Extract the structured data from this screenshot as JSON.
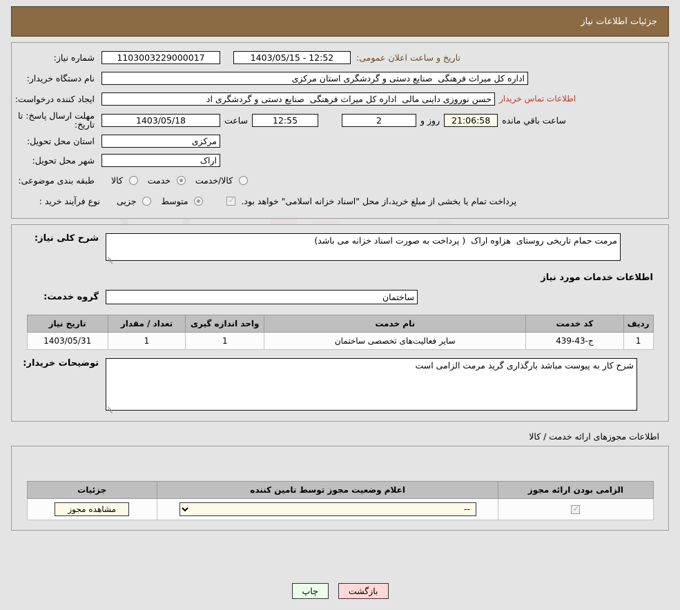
{
  "header": {
    "title": "جزئیات اطلاعات نیاز"
  },
  "form": {
    "need_number_label": "شماره نیاز:",
    "need_number_value": "1103003229000017",
    "announce_datetime_label": "تاریخ و ساعت اعلان عمومی:",
    "announce_datetime_value": "1403/05/15 - 12:52",
    "buyer_org_label": "نام دستگاه خریدار:",
    "buyer_org_value": "اداره کل میراث فرهنگی  صنایع دستی و گردشگری استان مرکزی",
    "requester_label": "ایجاد کننده درخواست:",
    "requester_value": "حسن نوروزی داینی مالی  اداره کل میراث فرهنگی  صنایع دستی و گردشگری اد",
    "buyer_contact_link": "اطلاعات تماس خریدار",
    "deadline_label": "مهلت ارسال پاسخ: تا تاریخ:",
    "deadline_date": "1403/05/18",
    "deadline_hour_label": "ساعت",
    "deadline_hour": "12:55",
    "remaining_days": "2",
    "remaining_days_label": "روز و",
    "remaining_time": "21:06:58",
    "remaining_time_label": "ساعت باقي مانده",
    "province_label": "استان محل تحویل:",
    "province_value": "مرکزی",
    "city_label": "شهر محل تحویل:",
    "city_value": "اراک",
    "category_label": "طبقه بندی موضوعی:",
    "category_options": [
      {
        "label": "کالا",
        "selected": false
      },
      {
        "label": "خدمت",
        "selected": true
      },
      {
        "label": "کالا/خدمت",
        "selected": false
      }
    ],
    "process_type_label": "نوع فرآیند خرید :",
    "process_options": [
      {
        "label": "جزیی",
        "selected": false
      },
      {
        "label": "متوسط",
        "selected": true
      }
    ],
    "treasury_checked": true,
    "treasury_note": "پرداخت تمام یا بخشی از مبلغ خرید،از محل \"اسناد خزانه اسلامی\" خواهد بود."
  },
  "need_description": {
    "label": "شرح کلی نیاز:",
    "value": "مرمت حمام تاریخی روستای  هزاوه اراک  ( پرداخت به صورت اسناد خزانه می باشد)"
  },
  "services_section": {
    "title": "اطلاعات خدمات مورد نیاز",
    "service_group_label": "گروه خدمت:",
    "service_group_value": "ساختمان",
    "table": {
      "columns": [
        "ردیف",
        "کد خدمت",
        "نام خدمت",
        "واحد اندازه گیری",
        "تعداد / مقدار",
        "تاریخ نیاز"
      ],
      "rows": [
        [
          "1",
          "ج-43-439",
          "سایر فعالیت‌های تخصصی ساختمان",
          "1",
          "1",
          "1403/05/31"
        ]
      ]
    },
    "buyer_notes_label": "توضیحات خریدار:",
    "buyer_notes_value": "شرح کار به پیوست مباشد بارگذاری گرید مرمت الزامی است"
  },
  "licenses_section": {
    "title": "اطلاعات مجوزهای ارائه خدمت / کالا",
    "table": {
      "columns": [
        "الزامی بودن ارائه مجوز",
        "اعلام وضعیت مجوز توسط تامین کننده",
        "جزئیات"
      ],
      "rows": [
        {
          "required_checked": true,
          "status_selected": "--",
          "status_options": [
            "--"
          ],
          "details_button": "مشاهده مجوز"
        }
      ]
    }
  },
  "footer": {
    "print_label": "چاپ",
    "back_label": "بازگشت"
  },
  "watermark": {
    "text_left": "Ana",
    "text_mid": "Tender",
    "text_right": ".net"
  },
  "colors": {
    "header_bg": "#8b6b43",
    "page_bg": "#e4e4e4",
    "link_red": "#c0392b",
    "print_btn": "#eaffea",
    "back_btn": "#ffd9d9"
  }
}
